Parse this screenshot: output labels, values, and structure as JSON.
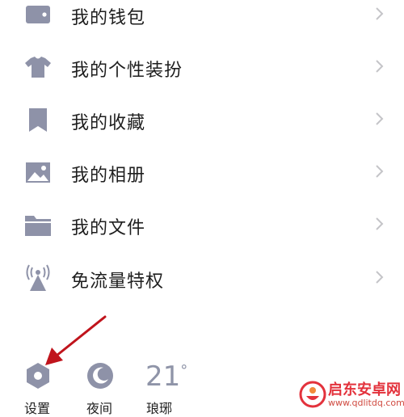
{
  "menu": {
    "items": [
      {
        "label": "我的钱包",
        "icon": "wallet-icon"
      },
      {
        "label": "我的个性装扮",
        "icon": "tshirt-icon"
      },
      {
        "label": "我的收藏",
        "icon": "bookmark-icon"
      },
      {
        "label": "我的相册",
        "icon": "photo-icon"
      },
      {
        "label": "我的文件",
        "icon": "folder-icon"
      },
      {
        "label": "免流量特权",
        "icon": "signal-tower-icon"
      }
    ]
  },
  "bottom_bar": {
    "settings_label": "设置",
    "night_label": "夜间",
    "weather_temp": "21",
    "weather_unit": "°",
    "weather_city": "琅琊"
  },
  "watermark": {
    "title": "启东安卓网",
    "url": "www.qdlitdq.com"
  },
  "colors": {
    "icon": "#8e92a8",
    "chevron": "#c4c4c8",
    "arrow": "#c0141c",
    "watermark": "#e3323c"
  }
}
